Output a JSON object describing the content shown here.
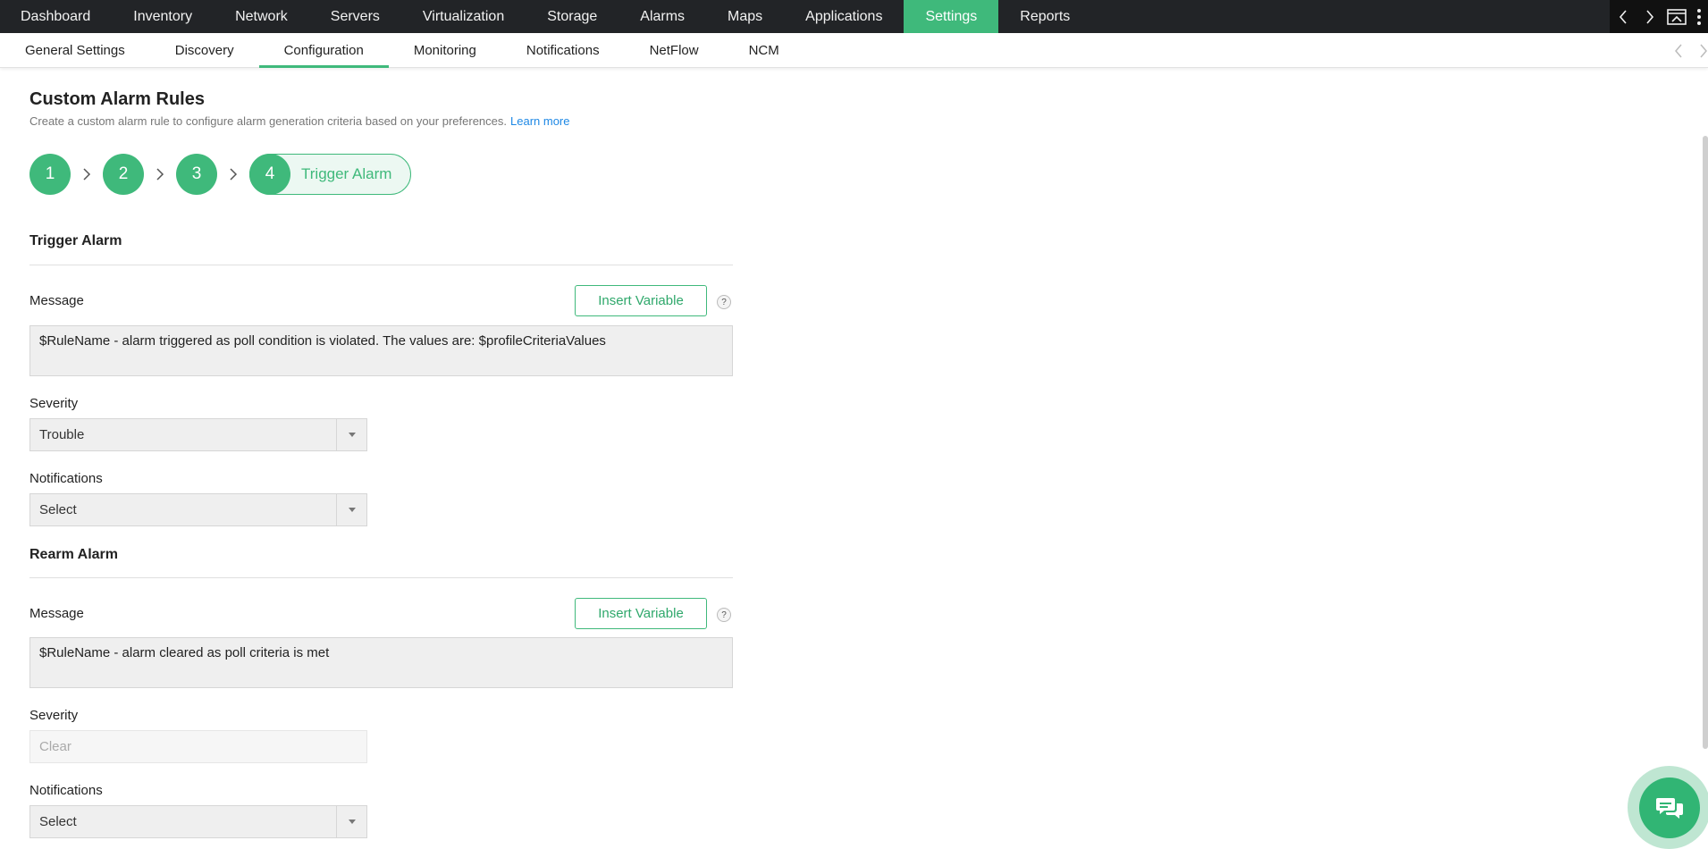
{
  "topnav": {
    "items": [
      {
        "label": "Dashboard"
      },
      {
        "label": "Inventory"
      },
      {
        "label": "Network"
      },
      {
        "label": "Servers"
      },
      {
        "label": "Virtualization"
      },
      {
        "label": "Storage"
      },
      {
        "label": "Alarms"
      },
      {
        "label": "Maps"
      },
      {
        "label": "Applications"
      },
      {
        "label": "Settings",
        "active": true
      },
      {
        "label": "Reports"
      }
    ],
    "tools": [
      "chevron-left-icon",
      "chevron-right-icon",
      "window-icon",
      "more-vertical-icon"
    ]
  },
  "subnav": {
    "items": [
      {
        "label": "General Settings"
      },
      {
        "label": "Discovery"
      },
      {
        "label": "Configuration",
        "active": true
      },
      {
        "label": "Monitoring"
      },
      {
        "label": "Notifications"
      },
      {
        "label": "NetFlow"
      },
      {
        "label": "NCM"
      }
    ]
  },
  "page": {
    "title": "Custom Alarm Rules",
    "description": "Create a custom alarm rule to configure alarm generation criteria based on your preferences.",
    "learn_more": "Learn more"
  },
  "steps": {
    "items": [
      "1",
      "2",
      "3",
      "4"
    ],
    "current_label": "Trigger Alarm"
  },
  "trigger": {
    "section_title": "Trigger Alarm",
    "message_label": "Message",
    "insert_variable": "Insert Variable",
    "help": "?",
    "message_value": "$RuleName - alarm triggered as poll condition is violated. The values are: $profileCriteriaValues",
    "severity_label": "Severity",
    "severity_value": "Trouble",
    "notifications_label": "Notifications",
    "notifications_value": "Select"
  },
  "rearm": {
    "section_title": "Rearm Alarm",
    "message_label": "Message",
    "insert_variable": "Insert Variable",
    "help": "?",
    "message_value": "$RuleName - alarm cleared as poll criteria is met",
    "severity_label": "Severity",
    "severity_value": "Clear",
    "notifications_label": "Notifications",
    "notifications_value": "Select"
  },
  "colors": {
    "accent": "#3fb97b",
    "topnav_bg": "#222427",
    "link": "#1e88e5"
  }
}
